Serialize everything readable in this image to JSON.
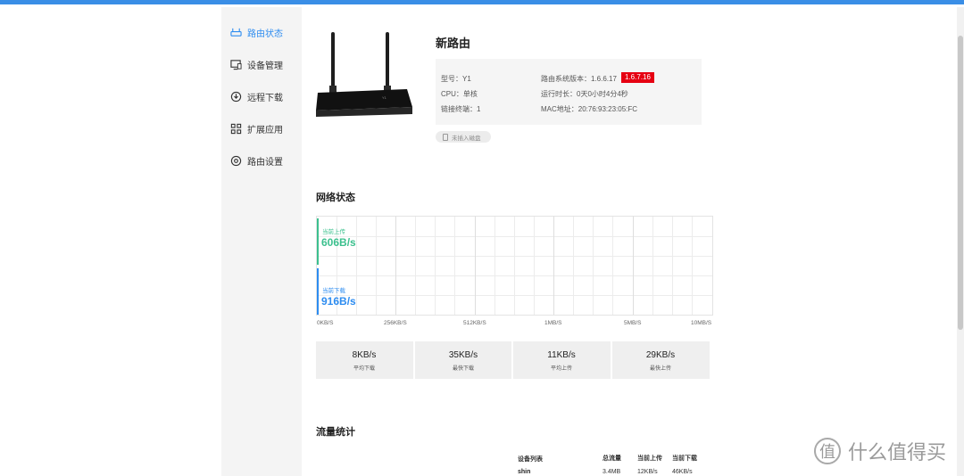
{
  "nav": {
    "items": [
      {
        "label": "路由状态",
        "icon": "router-icon",
        "active": true
      },
      {
        "label": "设备管理",
        "icon": "monitor-icon",
        "active": false
      },
      {
        "label": "远程下载",
        "icon": "download-icon",
        "active": false
      },
      {
        "label": "扩展应用",
        "icon": "apps-grid-icon",
        "active": false
      },
      {
        "label": "路由设置",
        "icon": "settings-icon",
        "active": false
      }
    ]
  },
  "router": {
    "name": "新路由",
    "model": "型号：Y1",
    "cpu": "CPU：单核",
    "clients": "链接终端：1",
    "firmware": "路由系统版本：1.6.6.17",
    "firmware_new": "1.6.7.16",
    "uptime": "运行时长：0天0小时4分4秒",
    "mac": "MAC地址：20:76:93:23:05:FC",
    "disk_status": "未插入磁盘"
  },
  "network": {
    "title": "网络状态",
    "upload_label": "当前上传",
    "upload_value": "606B/s",
    "download_label": "当前下载",
    "download_value": "916B/s",
    "axis": [
      "0KB/S",
      "256KB/S",
      "512KB/S",
      "1MB/S",
      "5MB/S",
      "10MB/S"
    ],
    "upload_color": "#3cc08e",
    "download_color": "#2d8cf0"
  },
  "stats": [
    {
      "value": "8KB/s",
      "label": "平均下载"
    },
    {
      "value": "35KB/s",
      "label": "最快下载"
    },
    {
      "value": "11KB/s",
      "label": "平均上传"
    },
    {
      "value": "29KB/s",
      "label": "最快上传"
    }
  ],
  "traffic": {
    "title": "流量统计",
    "headers": {
      "device": "设备列表",
      "total": "总流量",
      "up": "当前上传",
      "down": "当前下载"
    },
    "rows": [
      {
        "device": "shin",
        "total": "3.4MB",
        "up": "12KB/s",
        "down": "46KB/s"
      }
    ]
  },
  "watermark": {
    "glyph": "值",
    "text": "什么值得买"
  },
  "accent_color": "#3a8ee6"
}
